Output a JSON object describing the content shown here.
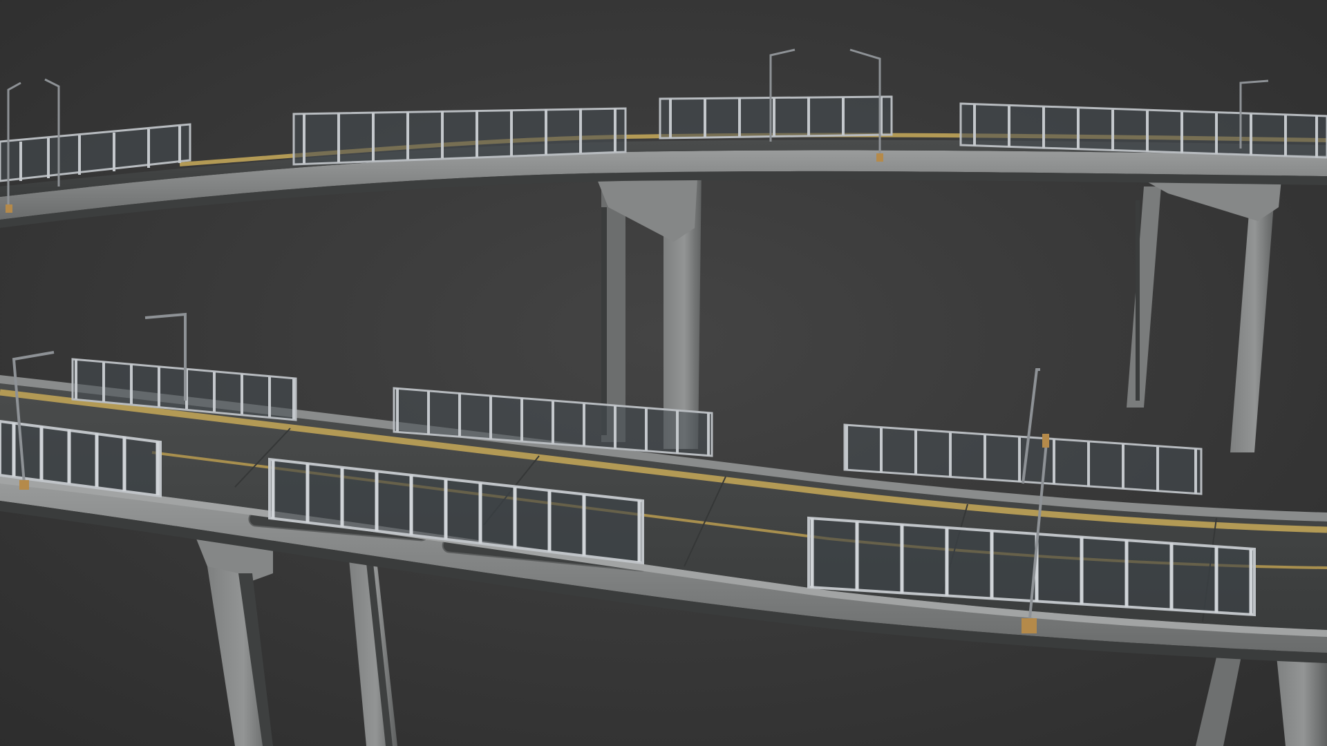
{
  "scene": {
    "subject": "elevated-highway-bridge-render",
    "colors": {
      "background_top": "#3f3f3f",
      "background_bottom": "#2f2f2f",
      "concrete_light": "#8d8f8f",
      "concrete_mid": "#6e7070",
      "concrete_dark": "#4a4c4c",
      "asphalt": "#434545",
      "asphalt_dark": "#373939",
      "yellow_line": "#b39a55",
      "rail_metal": "#b8bcc0",
      "rail_glass": "#4a4f55",
      "lamp_post": "#8e9296",
      "lamp_base": "#b58a4a"
    }
  }
}
